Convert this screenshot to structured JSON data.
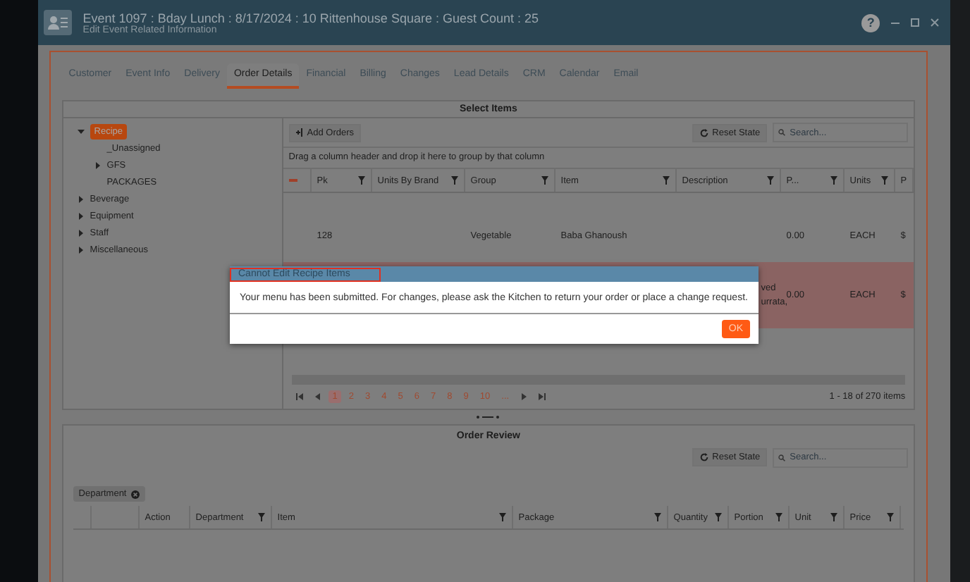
{
  "window": {
    "title": "Event 1097 : Bday Lunch : 8/17/2024 : 10 Rittenhouse Square : Guest Count : 25",
    "subtitle": "Edit Event Related Information",
    "help": "?"
  },
  "tabs": [
    {
      "label": "Customer",
      "selected": false
    },
    {
      "label": "Event Info",
      "selected": false
    },
    {
      "label": "Delivery",
      "selected": false
    },
    {
      "label": "Order Details",
      "selected": true
    },
    {
      "label": "Financial",
      "selected": false
    },
    {
      "label": "Billing",
      "selected": false
    },
    {
      "label": "Changes",
      "selected": false
    },
    {
      "label": "Lead Details",
      "selected": false
    },
    {
      "label": "CRM",
      "selected": false
    },
    {
      "label": "Calendar",
      "selected": false
    },
    {
      "label": "Email",
      "selected": false
    }
  ],
  "select_items": {
    "title": "Select Items",
    "tree": [
      {
        "label": "Recipe",
        "selected": true,
        "expanded": true,
        "children": [
          {
            "label": "_Unassigned"
          },
          {
            "label": "GFS",
            "expanded": false
          },
          {
            "label": "PACKAGES"
          }
        ]
      },
      {
        "label": "Beverage",
        "selected": false,
        "expanded": false
      },
      {
        "label": "Equipment",
        "selected": false,
        "expanded": false
      },
      {
        "label": "Staff",
        "selected": false,
        "expanded": false
      },
      {
        "label": "Miscellaneous",
        "selected": false,
        "expanded": false
      }
    ],
    "add_orders": "Add Orders",
    "reset_state": "Reset State",
    "search": {
      "placeholder": "Search..."
    },
    "group_hint": "Drag a column header and drop it here to group by that column",
    "columns": [
      "Pk",
      "Units By Brand",
      "Group",
      "Item",
      "Description",
      "P...",
      "Units",
      "P"
    ],
    "rows": [
      {
        "highlighted": false,
        "cells": [
          "128",
          "",
          "Vegetable",
          "Baba Ghanoush",
          "",
          "0.00",
          "EACH",
          "$"
        ]
      },
      {
        "highlighted": true,
        "cells": [
          "",
          "",
          "",
          "",
          "ved urrata,",
          "0.00",
          "EACH",
          "$"
        ]
      }
    ],
    "pager": {
      "pages": [
        {
          "label": "1",
          "selected": true
        },
        {
          "label": "2",
          "selected": false
        },
        {
          "label": "3",
          "selected": false
        },
        {
          "label": "4",
          "selected": false
        },
        {
          "label": "5",
          "selected": false
        },
        {
          "label": "6",
          "selected": false
        },
        {
          "label": "7",
          "selected": false
        },
        {
          "label": "8",
          "selected": false
        },
        {
          "label": "9",
          "selected": false
        },
        {
          "label": "10",
          "selected": false
        },
        {
          "label": "...",
          "selected": false
        }
      ],
      "summary": "1 - 18 of 270 items"
    }
  },
  "order_review": {
    "title": "Order Review",
    "reset_state": "Reset State",
    "search": {
      "placeholder": "Search..."
    },
    "group_chip": "Department",
    "columns": [
      {
        "label": "Action",
        "filter": false
      },
      {
        "label": "Department",
        "filter": true
      },
      {
        "label": "Item",
        "filter": true
      },
      {
        "label": "Package",
        "filter": true
      },
      {
        "label": "Quantity",
        "filter": true
      },
      {
        "label": "Portion",
        "filter": true
      },
      {
        "label": "Unit",
        "filter": true
      },
      {
        "label": "Price",
        "filter": true
      }
    ]
  },
  "dialog": {
    "title": "Cannot Edit Recipe Items",
    "message": "Your menu has been submitted. For changes, please ask the Kitchen to return your order or place a change request.",
    "ok": "OK"
  }
}
